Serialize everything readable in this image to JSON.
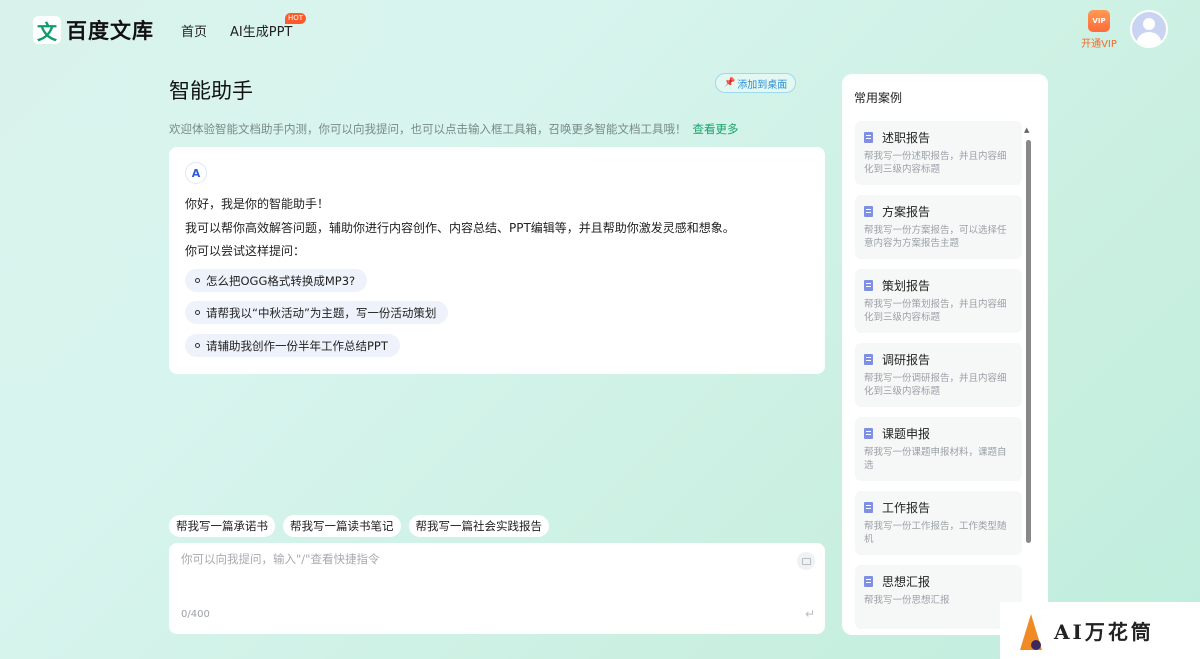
{
  "header": {
    "logo_mark": "文",
    "logo_text": "百度文库",
    "nav": [
      {
        "label": "首页"
      },
      {
        "label": "AI生成PPT",
        "badge": "HOT"
      }
    ],
    "vip_icon_text": "VIP",
    "vip_label": "开通VIP"
  },
  "main": {
    "title": "智能助手",
    "pin_label": "添加到桌面",
    "intro": "欢迎体验智能文档助手内测，你可以向我提问，也可以点击输入框工具箱，召唤更多智能文档工具哦！",
    "intro_link": "查看更多",
    "chat": {
      "bot_icon": "A",
      "lines": [
        "你好，我是你的智能助手！",
        "我可以帮你高效解答问题，辅助你进行内容创作、内容总结、PPT编辑等，并且帮助你激发灵感和想象。",
        "你可以尝试这样提问："
      ],
      "suggestions": [
        "怎么把OGG格式转换成MP3?",
        "请帮我以“中秋活动”为主题，写一份活动策划",
        "请辅助我创作一份半年工作总结PPT"
      ]
    },
    "quick_chips": [
      "帮我写一篇承诺书",
      "帮我写一篇读书笔记",
      "帮我写一篇社会实践报告"
    ],
    "input": {
      "value": "",
      "placeholder": "你可以向我提问，输入\"/\"查看快捷指令",
      "counter": "0/400",
      "send_glyph": "↵"
    }
  },
  "sidebar": {
    "title": "常用案例",
    "cases": [
      {
        "title": "述职报告",
        "desc": "帮我写一份述职报告，并且内容细化到三级内容标题"
      },
      {
        "title": "方案报告",
        "desc": "帮我写一份方案报告，可以选择任意内容为方案报告主题"
      },
      {
        "title": "策划报告",
        "desc": "帮我写一份策划报告，并且内容细化到三级内容标题"
      },
      {
        "title": "调研报告",
        "desc": "帮我写一份调研报告，并且内容细化到三级内容标题"
      },
      {
        "title": "课题申报",
        "desc": "帮我写一份课题申报材料，课题自选"
      },
      {
        "title": "工作报告",
        "desc": "帮我写一份工作报告，工作类型随机"
      },
      {
        "title": "思想汇报",
        "desc": "帮我写一份思想汇报"
      }
    ]
  },
  "watermark": {
    "text": "AI万花筒"
  },
  "colors": {
    "accent": "#1aa36d",
    "vip": "#f26a2a",
    "link_blue": "#2c8fd6",
    "doc_icon": "#7f8fe3"
  }
}
